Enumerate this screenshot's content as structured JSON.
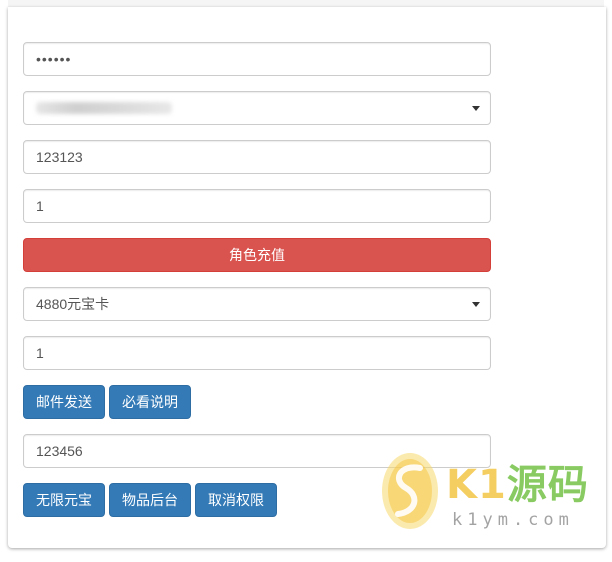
{
  "form": {
    "password_value": "••••••",
    "server_select_value": "",
    "role_input_value": "123123",
    "amount_input_value": "1",
    "recharge_button_label": "角色充值",
    "item_select_value": "4880元宝卡",
    "item_quantity_value": "1",
    "mail_send_button_label": "邮件发送",
    "instructions_button_label": "必看说明",
    "code_input_value": "123456",
    "unlimited_ingot_button_label": "无限元宝",
    "items_backend_button_label": "物品后台",
    "revoke_permission_button_label": "取消权限"
  },
  "watermark": {
    "brand_k": "K",
    "brand_1": "1",
    "brand_cn": "源码",
    "domain": "k1ym.com"
  },
  "colors": {
    "danger": "#d9534f",
    "primary": "#337ab7",
    "watermark_yellow": "#f2c23a",
    "watermark_green": "#6cbf3c"
  }
}
